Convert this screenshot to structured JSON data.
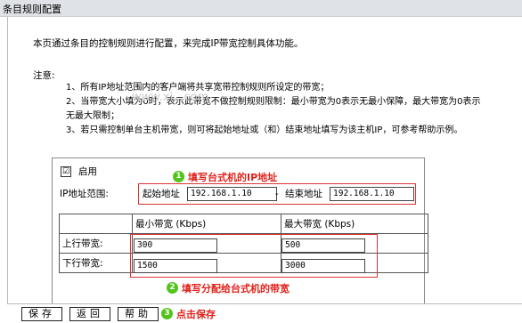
{
  "window": {
    "title": "条目规则配置"
  },
  "intro": "本页通过条目的控制规则进行配置，来完成IP带宽控制具体功能。",
  "notes": {
    "heading": "注意:",
    "line1": "1、所有IP地址范围内的客户端将共享宽带控制规则所设定的带宽；",
    "line2a": "2、当带宽大小填为0时，表示此带宽不做控制规则限制：最小带宽为0表示无最小保障，最大带宽为0表示",
    "line2b": "无最大限制；",
    "line3": "3、若只需控制单台主机带宽，则可将起始地址或（和）结束地址填写为该主机IP，可参考帮助示例。"
  },
  "watermark": "www.xi...com",
  "form": {
    "enable_checked": true,
    "enable_label": "启用",
    "check_mark": "☑",
    "ip_range_label": "IP地址范围:",
    "start_label": "起始地址",
    "start_value": "192.168.1.10",
    "separator": "-",
    "end_label": "结束地址",
    "end_value": "192.168.1.10"
  },
  "bandwidth_table": {
    "col_min": "最小带宽 (Kbps)",
    "col_max": "最大带宽 (Kbps)",
    "rows": [
      {
        "label": "上行带宽:",
        "min": "300",
        "max": "500"
      },
      {
        "label": "下行带宽:",
        "min": "1500",
        "max": "3000"
      }
    ]
  },
  "callouts": {
    "c1_num": "1",
    "c1_text": "填写台式机的IP地址",
    "c2_num": "2",
    "c2_text": "填写分配给台式机的带宽",
    "c3_num": "3",
    "c3_text": "点击保存"
  },
  "buttons": {
    "save": "保存",
    "back": "返回",
    "help": "帮助"
  },
  "colors": {
    "callout_red": "#e0211a",
    "callout_green": "#52c41a"
  }
}
